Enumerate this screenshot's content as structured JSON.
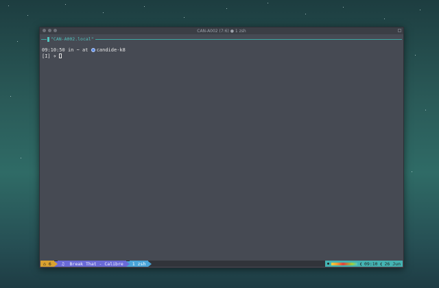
{
  "window": {
    "title": "CAN-A002 (7:6) ● 1 zsh"
  },
  "tab": {
    "label": "\"CAN-A002.local\""
  },
  "terminal": {
    "time": "09:10:50",
    "connector1": "in",
    "path": "~",
    "connector2": "at",
    "host": "candide-k8",
    "mode": "[I]",
    "prompt_icon": "✈"
  },
  "statusbar": {
    "session_icon": "⌂",
    "session_count": "6",
    "song_icon": "♫",
    "song": "Break That - Calibre",
    "window_index": "1",
    "window_name": "zsh",
    "time": "09:10",
    "date": "26 Jun",
    "separator": "❮"
  },
  "colors": {
    "accent_teal": "#52c5bf",
    "status_orange": "#d9a230",
    "status_purple": "#6a6ad6",
    "status_blue": "#49a4d8",
    "terminal_bg": "#464a53"
  }
}
